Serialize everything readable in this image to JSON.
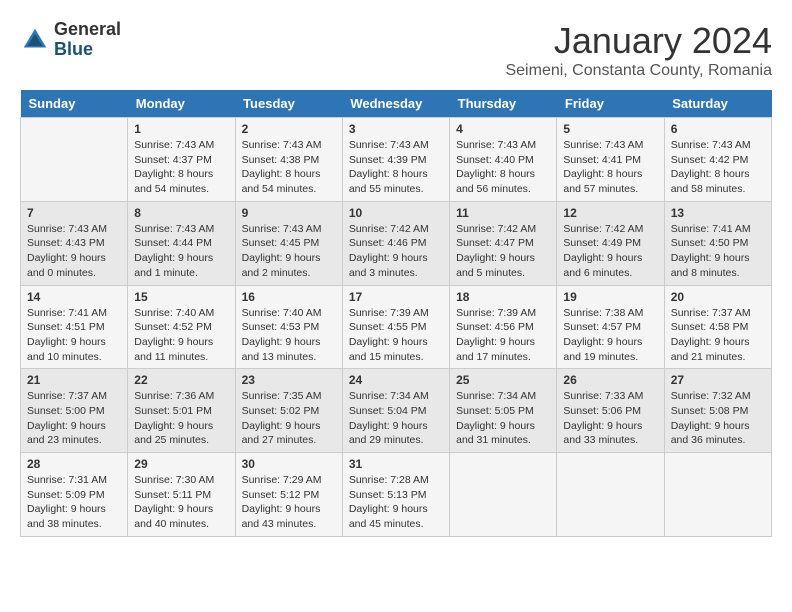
{
  "header": {
    "logo_general": "General",
    "logo_blue": "Blue",
    "month": "January 2024",
    "location": "Seimeni, Constanta County, Romania"
  },
  "days_of_week": [
    "Sunday",
    "Monday",
    "Tuesday",
    "Wednesday",
    "Thursday",
    "Friday",
    "Saturday"
  ],
  "weeks": [
    [
      {
        "day": "",
        "info": ""
      },
      {
        "day": "1",
        "info": "Sunrise: 7:43 AM\nSunset: 4:37 PM\nDaylight: 8 hours\nand 54 minutes."
      },
      {
        "day": "2",
        "info": "Sunrise: 7:43 AM\nSunset: 4:38 PM\nDaylight: 8 hours\nand 54 minutes."
      },
      {
        "day": "3",
        "info": "Sunrise: 7:43 AM\nSunset: 4:39 PM\nDaylight: 8 hours\nand 55 minutes."
      },
      {
        "day": "4",
        "info": "Sunrise: 7:43 AM\nSunset: 4:40 PM\nDaylight: 8 hours\nand 56 minutes."
      },
      {
        "day": "5",
        "info": "Sunrise: 7:43 AM\nSunset: 4:41 PM\nDaylight: 8 hours\nand 57 minutes."
      },
      {
        "day": "6",
        "info": "Sunrise: 7:43 AM\nSunset: 4:42 PM\nDaylight: 8 hours\nand 58 minutes."
      }
    ],
    [
      {
        "day": "7",
        "info": "Sunrise: 7:43 AM\nSunset: 4:43 PM\nDaylight: 9 hours\nand 0 minutes."
      },
      {
        "day": "8",
        "info": "Sunrise: 7:43 AM\nSunset: 4:44 PM\nDaylight: 9 hours\nand 1 minute."
      },
      {
        "day": "9",
        "info": "Sunrise: 7:43 AM\nSunset: 4:45 PM\nDaylight: 9 hours\nand 2 minutes."
      },
      {
        "day": "10",
        "info": "Sunrise: 7:42 AM\nSunset: 4:46 PM\nDaylight: 9 hours\nand 3 minutes."
      },
      {
        "day": "11",
        "info": "Sunrise: 7:42 AM\nSunset: 4:47 PM\nDaylight: 9 hours\nand 5 minutes."
      },
      {
        "day": "12",
        "info": "Sunrise: 7:42 AM\nSunset: 4:49 PM\nDaylight: 9 hours\nand 6 minutes."
      },
      {
        "day": "13",
        "info": "Sunrise: 7:41 AM\nSunset: 4:50 PM\nDaylight: 9 hours\nand 8 minutes."
      }
    ],
    [
      {
        "day": "14",
        "info": "Sunrise: 7:41 AM\nSunset: 4:51 PM\nDaylight: 9 hours\nand 10 minutes."
      },
      {
        "day": "15",
        "info": "Sunrise: 7:40 AM\nSunset: 4:52 PM\nDaylight: 9 hours\nand 11 minutes."
      },
      {
        "day": "16",
        "info": "Sunrise: 7:40 AM\nSunset: 4:53 PM\nDaylight: 9 hours\nand 13 minutes."
      },
      {
        "day": "17",
        "info": "Sunrise: 7:39 AM\nSunset: 4:55 PM\nDaylight: 9 hours\nand 15 minutes."
      },
      {
        "day": "18",
        "info": "Sunrise: 7:39 AM\nSunset: 4:56 PM\nDaylight: 9 hours\nand 17 minutes."
      },
      {
        "day": "19",
        "info": "Sunrise: 7:38 AM\nSunset: 4:57 PM\nDaylight: 9 hours\nand 19 minutes."
      },
      {
        "day": "20",
        "info": "Sunrise: 7:37 AM\nSunset: 4:58 PM\nDaylight: 9 hours\nand 21 minutes."
      }
    ],
    [
      {
        "day": "21",
        "info": "Sunrise: 7:37 AM\nSunset: 5:00 PM\nDaylight: 9 hours\nand 23 minutes."
      },
      {
        "day": "22",
        "info": "Sunrise: 7:36 AM\nSunset: 5:01 PM\nDaylight: 9 hours\nand 25 minutes."
      },
      {
        "day": "23",
        "info": "Sunrise: 7:35 AM\nSunset: 5:02 PM\nDaylight: 9 hours\nand 27 minutes."
      },
      {
        "day": "24",
        "info": "Sunrise: 7:34 AM\nSunset: 5:04 PM\nDaylight: 9 hours\nand 29 minutes."
      },
      {
        "day": "25",
        "info": "Sunrise: 7:34 AM\nSunset: 5:05 PM\nDaylight: 9 hours\nand 31 minutes."
      },
      {
        "day": "26",
        "info": "Sunrise: 7:33 AM\nSunset: 5:06 PM\nDaylight: 9 hours\nand 33 minutes."
      },
      {
        "day": "27",
        "info": "Sunrise: 7:32 AM\nSunset: 5:08 PM\nDaylight: 9 hours\nand 36 minutes."
      }
    ],
    [
      {
        "day": "28",
        "info": "Sunrise: 7:31 AM\nSunset: 5:09 PM\nDaylight: 9 hours\nand 38 minutes."
      },
      {
        "day": "29",
        "info": "Sunrise: 7:30 AM\nSunset: 5:11 PM\nDaylight: 9 hours\nand 40 minutes."
      },
      {
        "day": "30",
        "info": "Sunrise: 7:29 AM\nSunset: 5:12 PM\nDaylight: 9 hours\nand 43 minutes."
      },
      {
        "day": "31",
        "info": "Sunrise: 7:28 AM\nSunset: 5:13 PM\nDaylight: 9 hours\nand 45 minutes."
      },
      {
        "day": "",
        "info": ""
      },
      {
        "day": "",
        "info": ""
      },
      {
        "day": "",
        "info": ""
      }
    ]
  ]
}
